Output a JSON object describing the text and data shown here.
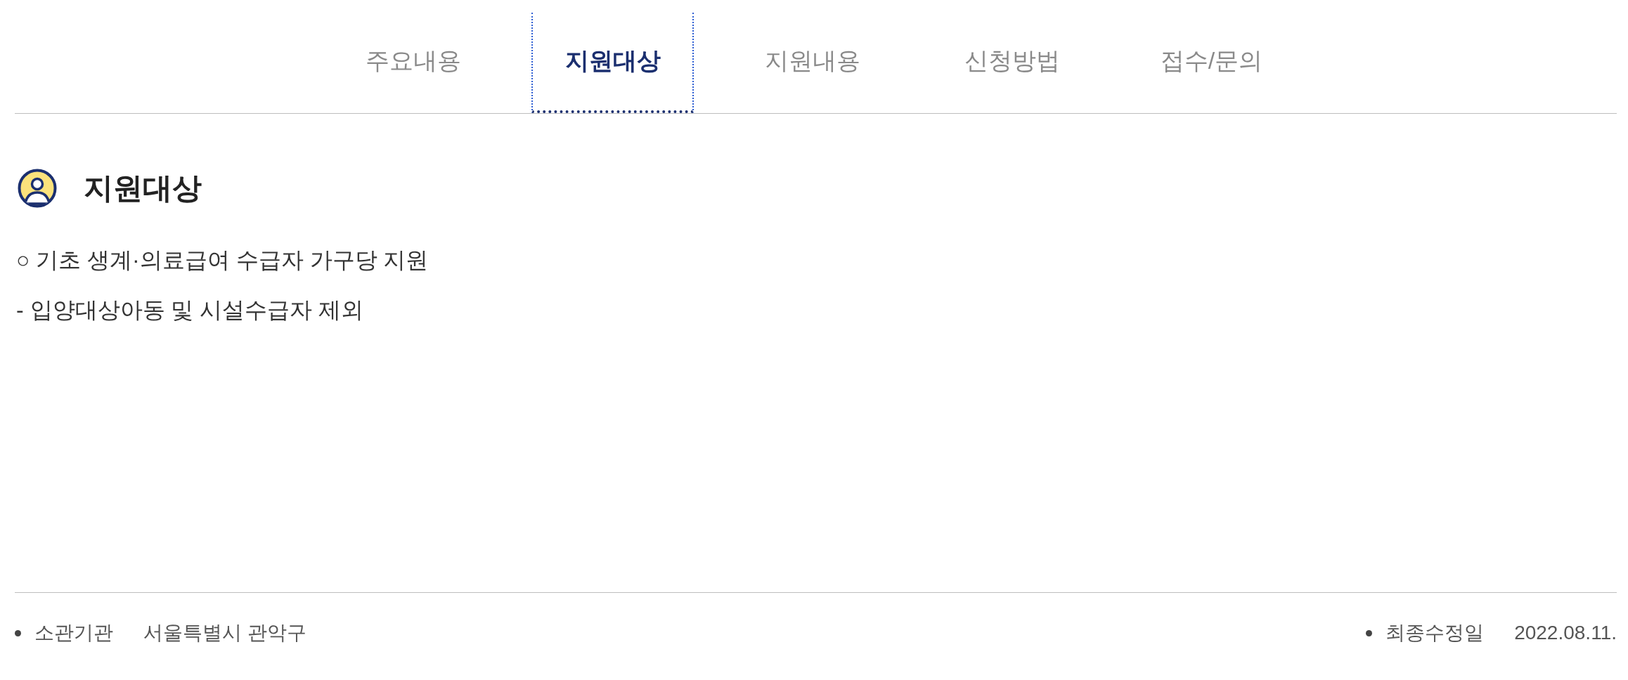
{
  "tabs": [
    {
      "label": "주요내용",
      "selected": false
    },
    {
      "label": "지원대상",
      "selected": true
    },
    {
      "label": "지원내용",
      "selected": false
    },
    {
      "label": "신청방법",
      "selected": false
    },
    {
      "label": "접수/문의",
      "selected": false
    }
  ],
  "section": {
    "title": "지원대상",
    "lines": [
      "○ 기초 생계·의료급여 수급자 가구당 지원",
      "- 입양대상아동 및 시설수급자 제외"
    ]
  },
  "footer": {
    "items": [
      {
        "label": "소관기관",
        "value": "서울특별시 관악구"
      },
      {
        "label": "최종수정일",
        "value": "2022.08.11."
      }
    ]
  }
}
